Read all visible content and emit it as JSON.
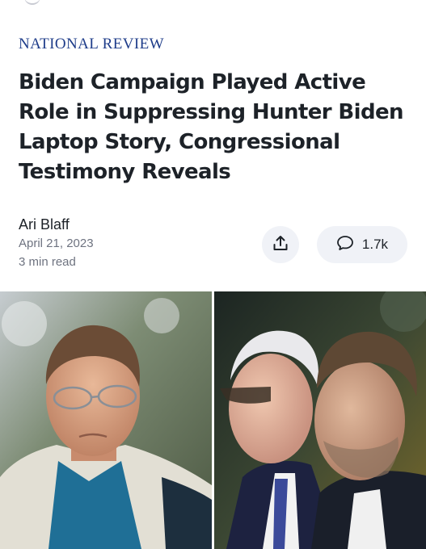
{
  "article": {
    "publisher": "NATIONAL REVIEW",
    "headline": "Biden Campaign Played Active Role in Suppressing Hunter Biden Laptop Story, Congressional Testimony Reveals",
    "author": "Ari Blaff",
    "date": "April 21, 2023",
    "read_time": "3 min read"
  },
  "actions": {
    "share_icon": "share-icon",
    "comments_icon": "speech-bubble-icon",
    "comment_count": "1.7k"
  },
  "colors": {
    "publisher": "#1f3d8a",
    "text": "#1d2228",
    "meta": "#6e7380",
    "button_bg": "#f0f2f7"
  }
}
